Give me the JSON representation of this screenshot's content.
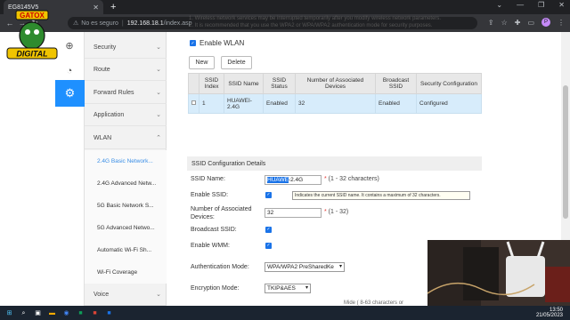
{
  "browser": {
    "tab_title": "EG8145V5",
    "url_insecure_label": "No es seguro",
    "url_host": "192.168.18.1",
    "url_path": "/index.asp",
    "profile_initial": "P"
  },
  "logo": {
    "top_text": "GATOX",
    "bottom_text": "DIGITAL"
  },
  "nav_menu": {
    "items": [
      {
        "label": "Security"
      },
      {
        "label": "Route"
      },
      {
        "label": "Forward Rules"
      },
      {
        "label": "Application"
      },
      {
        "label": "WLAN"
      }
    ],
    "wlan_sub": [
      {
        "label": "2.4G Basic Network..."
      },
      {
        "label": "2.4G Advanced Netw..."
      },
      {
        "label": "5G Basic Network S..."
      },
      {
        "label": "5G Advanced Netwo..."
      },
      {
        "label": "Automatic Wi-Fi Sh..."
      },
      {
        "label": "Wi-Fi Coverage"
      }
    ],
    "voice_label": "Voice"
  },
  "main": {
    "note1": "1. Wireless network services may be interrupted temporarily after you modify wireless network parameters.",
    "note2": "2. It is recommended that you use the WPA2 or WPA/WPA2 authentication mode for security purposes.",
    "enable_wlan_label": "Enable WLAN",
    "new_button": "New",
    "delete_button": "Delete",
    "table": {
      "headers": [
        "SSID Index",
        "SSID Name",
        "SSID Status",
        "Number of Associated Devices",
        "Broadcast SSID",
        "Security Configuration"
      ],
      "rows": [
        {
          "index": "1",
          "name": "HUAWEI-2.4G",
          "status": "Enabled",
          "devices": "32",
          "broadcast": "Enabled",
          "security": "Configured"
        }
      ]
    },
    "config_header": "SSID Configuration Details",
    "ssid_name_label": "SSID Name:",
    "ssid_name_selected": "HUAWE",
    "ssid_name_rest": "-2.4G",
    "ssid_name_hint": "(1 - 32 characters)",
    "enable_ssid_label": "Enable SSID:",
    "tooltip": "Indicates the current SSID name. It contains a maximum of 32 characters.",
    "assoc_label_1": "Number of Associated",
    "assoc_label_2": "Devices:",
    "assoc_value": "32",
    "assoc_hint": "(1 - 32)",
    "broadcast_label": "Broadcast SSID:",
    "wmm_label": "Enable WMM:",
    "auth_label": "Authentication Mode:",
    "auth_value": "WPA/WPA2 PreSharedKe",
    "enc_label": "Encryption Mode:",
    "enc_value": "TKIP&AES",
    "partial_hint": "Mide ( 8-63 characters or"
  },
  "taskbar": {
    "time": "13:50",
    "date": "21/05/2023"
  }
}
